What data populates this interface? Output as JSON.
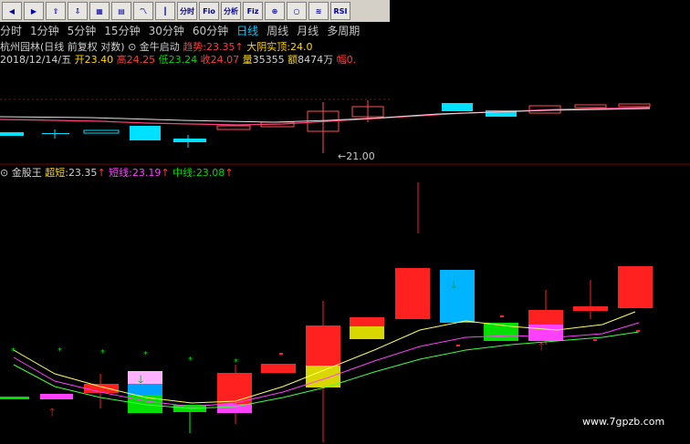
{
  "toolbar": {
    "buttons": [
      "back-icon",
      "forward-icon",
      "up-icon",
      "down-icon",
      "table-icon",
      "chart-icon",
      "kline-icon",
      "tool-icon",
      "分时",
      "F10",
      "分析",
      "F1Z",
      "SDS",
      "circle-icon",
      "wave-icon",
      "RSI",
      "list-icon"
    ],
    "labels": {
      "b8": "分时",
      "b9": "Fio",
      "b10": "分析",
      "b11": "Fiz",
      "b12": "⊕",
      "b15": "RSI"
    }
  },
  "periods": [
    "分时",
    "1分钟",
    "5分钟",
    "15分钟",
    "30分钟",
    "60分钟",
    "日线",
    "周线",
    "月线",
    "多周期"
  ],
  "active_period": "日线",
  "stock": {
    "name": "杭州园林",
    "mode": "(日线 前复权 对数)",
    "signal_name": "金牛启动",
    "trend_label": "趋势:",
    "trend_value": "23.35",
    "arrow": "↑",
    "big_yin_label": "大阴实顶:",
    "big_yin_value": "24.0",
    "date": "2018/12/14/五",
    "open_label": "开",
    "open": "23.40",
    "high_label": "高",
    "high": "24.25",
    "low_label": "低",
    "low": "23.24",
    "close_label": "收",
    "close": "24.07",
    "vol_label": "量",
    "vol": "35355",
    "amt_label": "额",
    "amt": "8474万",
    "amp_label": "幅",
    "amp": "0."
  },
  "low_marker": "←21.00",
  "indicator": {
    "name": "金股王",
    "ultra_label": "超短:",
    "ultra": "23.35",
    "short_label": "短线:",
    "short": "23.19",
    "mid_label": "中线:",
    "mid": "23.08",
    "arrow": "↑"
  },
  "watermark": "www.7gpzb.com",
  "colors": {
    "bg": "#000000",
    "up": "#ff3c3c",
    "down": "#00e0ff",
    "ma1": "#ff4080",
    "ma2": "#e0e0e0"
  }
}
